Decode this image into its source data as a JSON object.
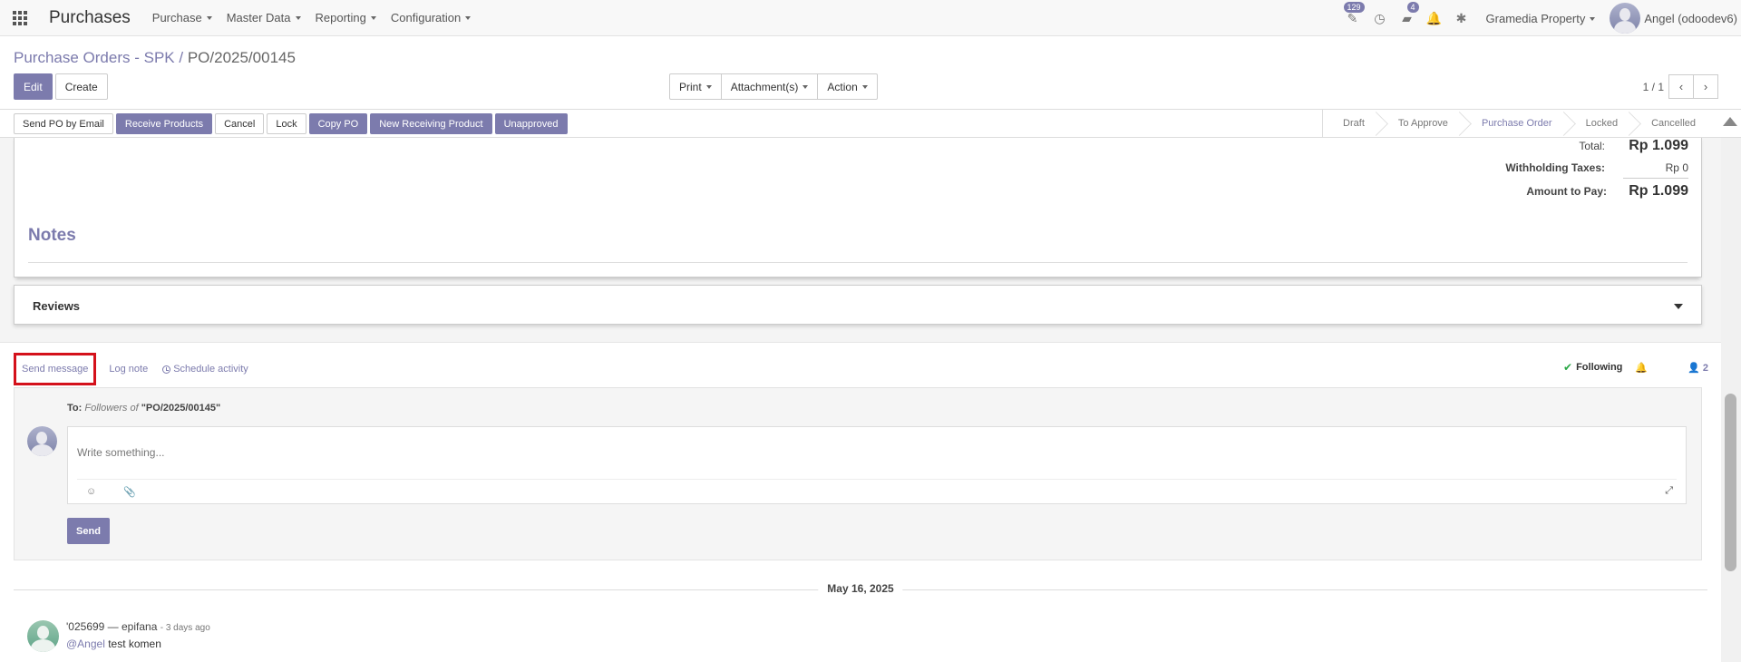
{
  "navbar": {
    "app_title": "Purchases",
    "menus": [
      "Purchase",
      "Master Data",
      "Reporting",
      "Configuration"
    ],
    "activity_badge": "129",
    "messages_badge": "4",
    "company": "Gramedia Property",
    "user": "Angel (odoodev6)"
  },
  "breadcrumb": {
    "parent": "Purchase Orders - SPK",
    "separator": "/",
    "current": "PO/2025/00145"
  },
  "control_panel": {
    "edit": "Edit",
    "create": "Create",
    "print": "Print",
    "attachments": "Attachment(s)",
    "action": "Action",
    "pager_value": "1 / 1"
  },
  "statusbar": {
    "buttons": {
      "send_po": "Send PO by Email",
      "receive": "Receive Products",
      "cancel": "Cancel",
      "lock": "Lock",
      "copy_po": "Copy PO",
      "new_receiving": "New Receiving Product",
      "unapproved": "Unapproved"
    },
    "stages": [
      "Draft",
      "To Approve",
      "Purchase Order",
      "Locked",
      "Cancelled"
    ],
    "current_stage": "Purchase Order"
  },
  "totals": {
    "total_label": "Total:",
    "total_value": "Rp 1.099",
    "withholding_label": "Withholding Taxes:",
    "withholding_value": "Rp 0",
    "amount_label": "Amount to Pay:",
    "amount_value": "Rp 1.099"
  },
  "notes": {
    "title": "Notes"
  },
  "reviews": {
    "title": "Reviews"
  },
  "chatter": {
    "send_message": "Send message",
    "log_note": "Log note",
    "schedule_activity": "Schedule activity",
    "following": "Following",
    "follower_count": "2",
    "to_label": "To:",
    "followers_of": "Followers of",
    "record_name": "\"PO/2025/00145\"",
    "placeholder": "Write something...",
    "send": "Send",
    "date_separator": "May 16, 2025",
    "message": {
      "author": "'025699 — epifana",
      "when": "- 3 days ago",
      "mention": "@Angel",
      "body": " test komen"
    }
  }
}
